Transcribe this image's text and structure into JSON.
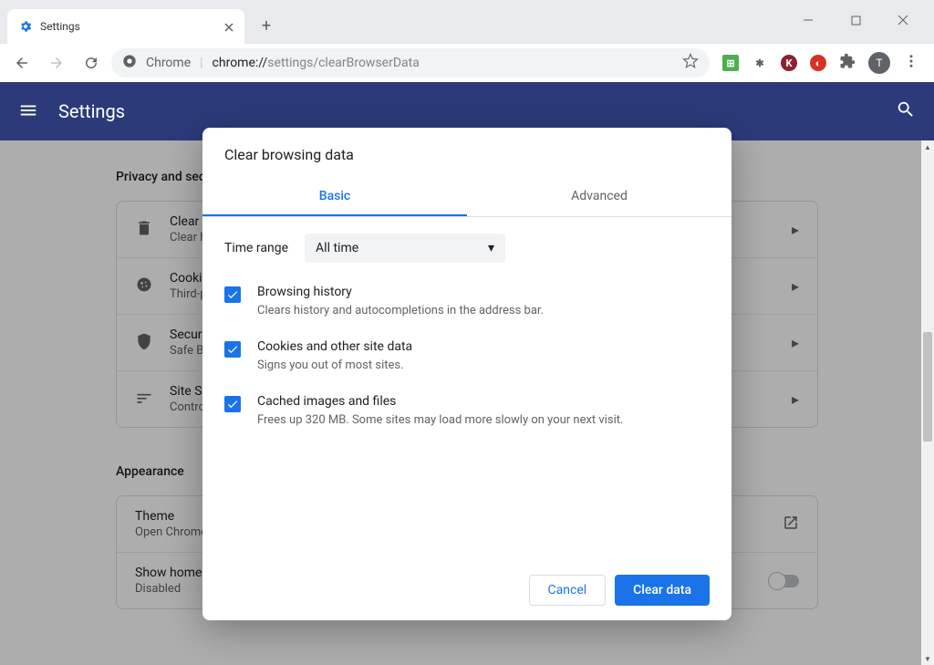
{
  "window": {
    "tab_title": "Settings",
    "url_prefix": "Chrome",
    "url_path_strong": "chrome://",
    "url_path_rest": "settings/clearBrowserData",
    "avatar_letter": "T"
  },
  "header": {
    "title": "Settings"
  },
  "sections": {
    "privacy": {
      "title": "Privacy and security",
      "rows": [
        {
          "title": "Clear browsing data",
          "sub": "Clear history, cookies, cache, and more"
        },
        {
          "title": "Cookies and other site data",
          "sub": "Third-party cookies are blocked in Incognito mode"
        },
        {
          "title": "Security",
          "sub": "Safe Browsing (protection from dangerous sites) and other security settings"
        },
        {
          "title": "Site Settings",
          "sub": "Controls what information sites can use and show"
        }
      ]
    },
    "appearance": {
      "title": "Appearance",
      "theme": {
        "title": "Theme",
        "sub": "Open Chrome Web Store"
      },
      "home": {
        "title": "Show home button",
        "sub": "Disabled"
      }
    }
  },
  "dialog": {
    "title": "Clear browsing data",
    "tabs": {
      "basic": "Basic",
      "advanced": "Advanced"
    },
    "time_label": "Time range",
    "time_value": "All time",
    "items": [
      {
        "title": "Browsing history",
        "sub": "Clears history and autocompletions in the address bar."
      },
      {
        "title": "Cookies and other site data",
        "sub": "Signs you out of most sites."
      },
      {
        "title": "Cached images and files",
        "sub": "Frees up 320 MB. Some sites may load more slowly on your next visit."
      }
    ],
    "cancel": "Cancel",
    "clear": "Clear data"
  }
}
